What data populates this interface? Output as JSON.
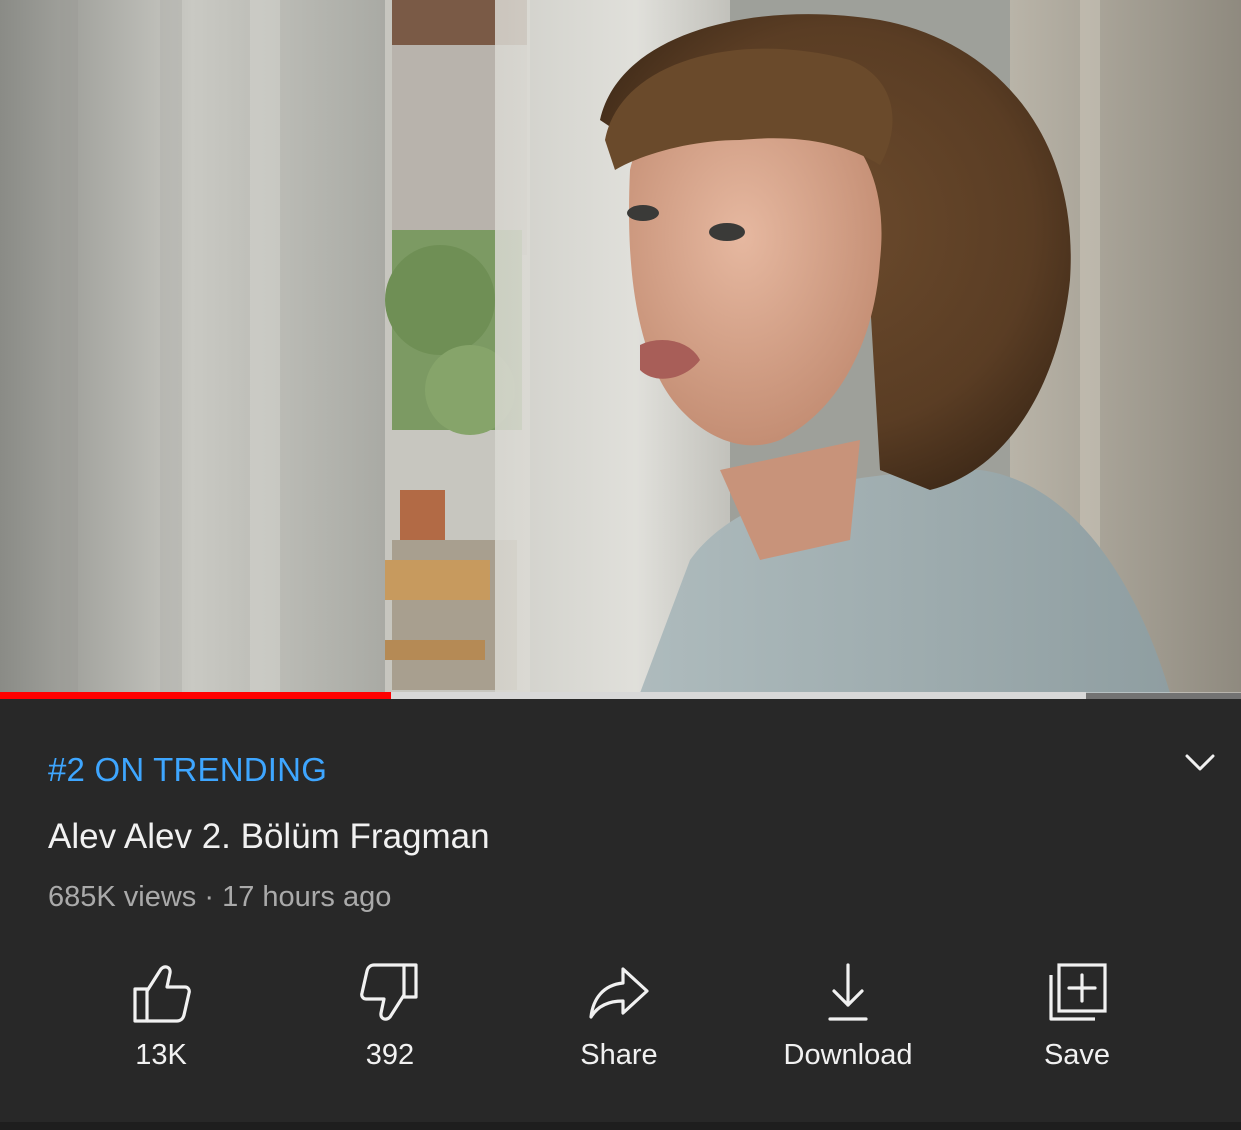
{
  "video": {
    "progress_played": 0.315,
    "progress_buffered": 0.875,
    "accent_color": "#ff0000"
  },
  "info": {
    "trending_label": "#2 ON TRENDING",
    "title": "Alev Alev 2. Bölüm Fragman",
    "meta": "685K views · 17 hours ago",
    "expand_icon": "chevron-down-icon"
  },
  "actions": {
    "like": {
      "label": "13K",
      "icon": "thumbs-up-icon"
    },
    "dislike": {
      "label": "392",
      "icon": "thumbs-down-icon"
    },
    "share": {
      "label": "Share",
      "icon": "share-arrow-icon"
    },
    "download": {
      "label": "Download",
      "icon": "download-icon"
    },
    "save": {
      "label": "Save",
      "icon": "add-to-playlist-icon"
    }
  },
  "colors": {
    "background": "#282828",
    "trending": "#3ea6ff",
    "text_primary": "#f1f1f1",
    "text_secondary": "#aaaaaa"
  }
}
